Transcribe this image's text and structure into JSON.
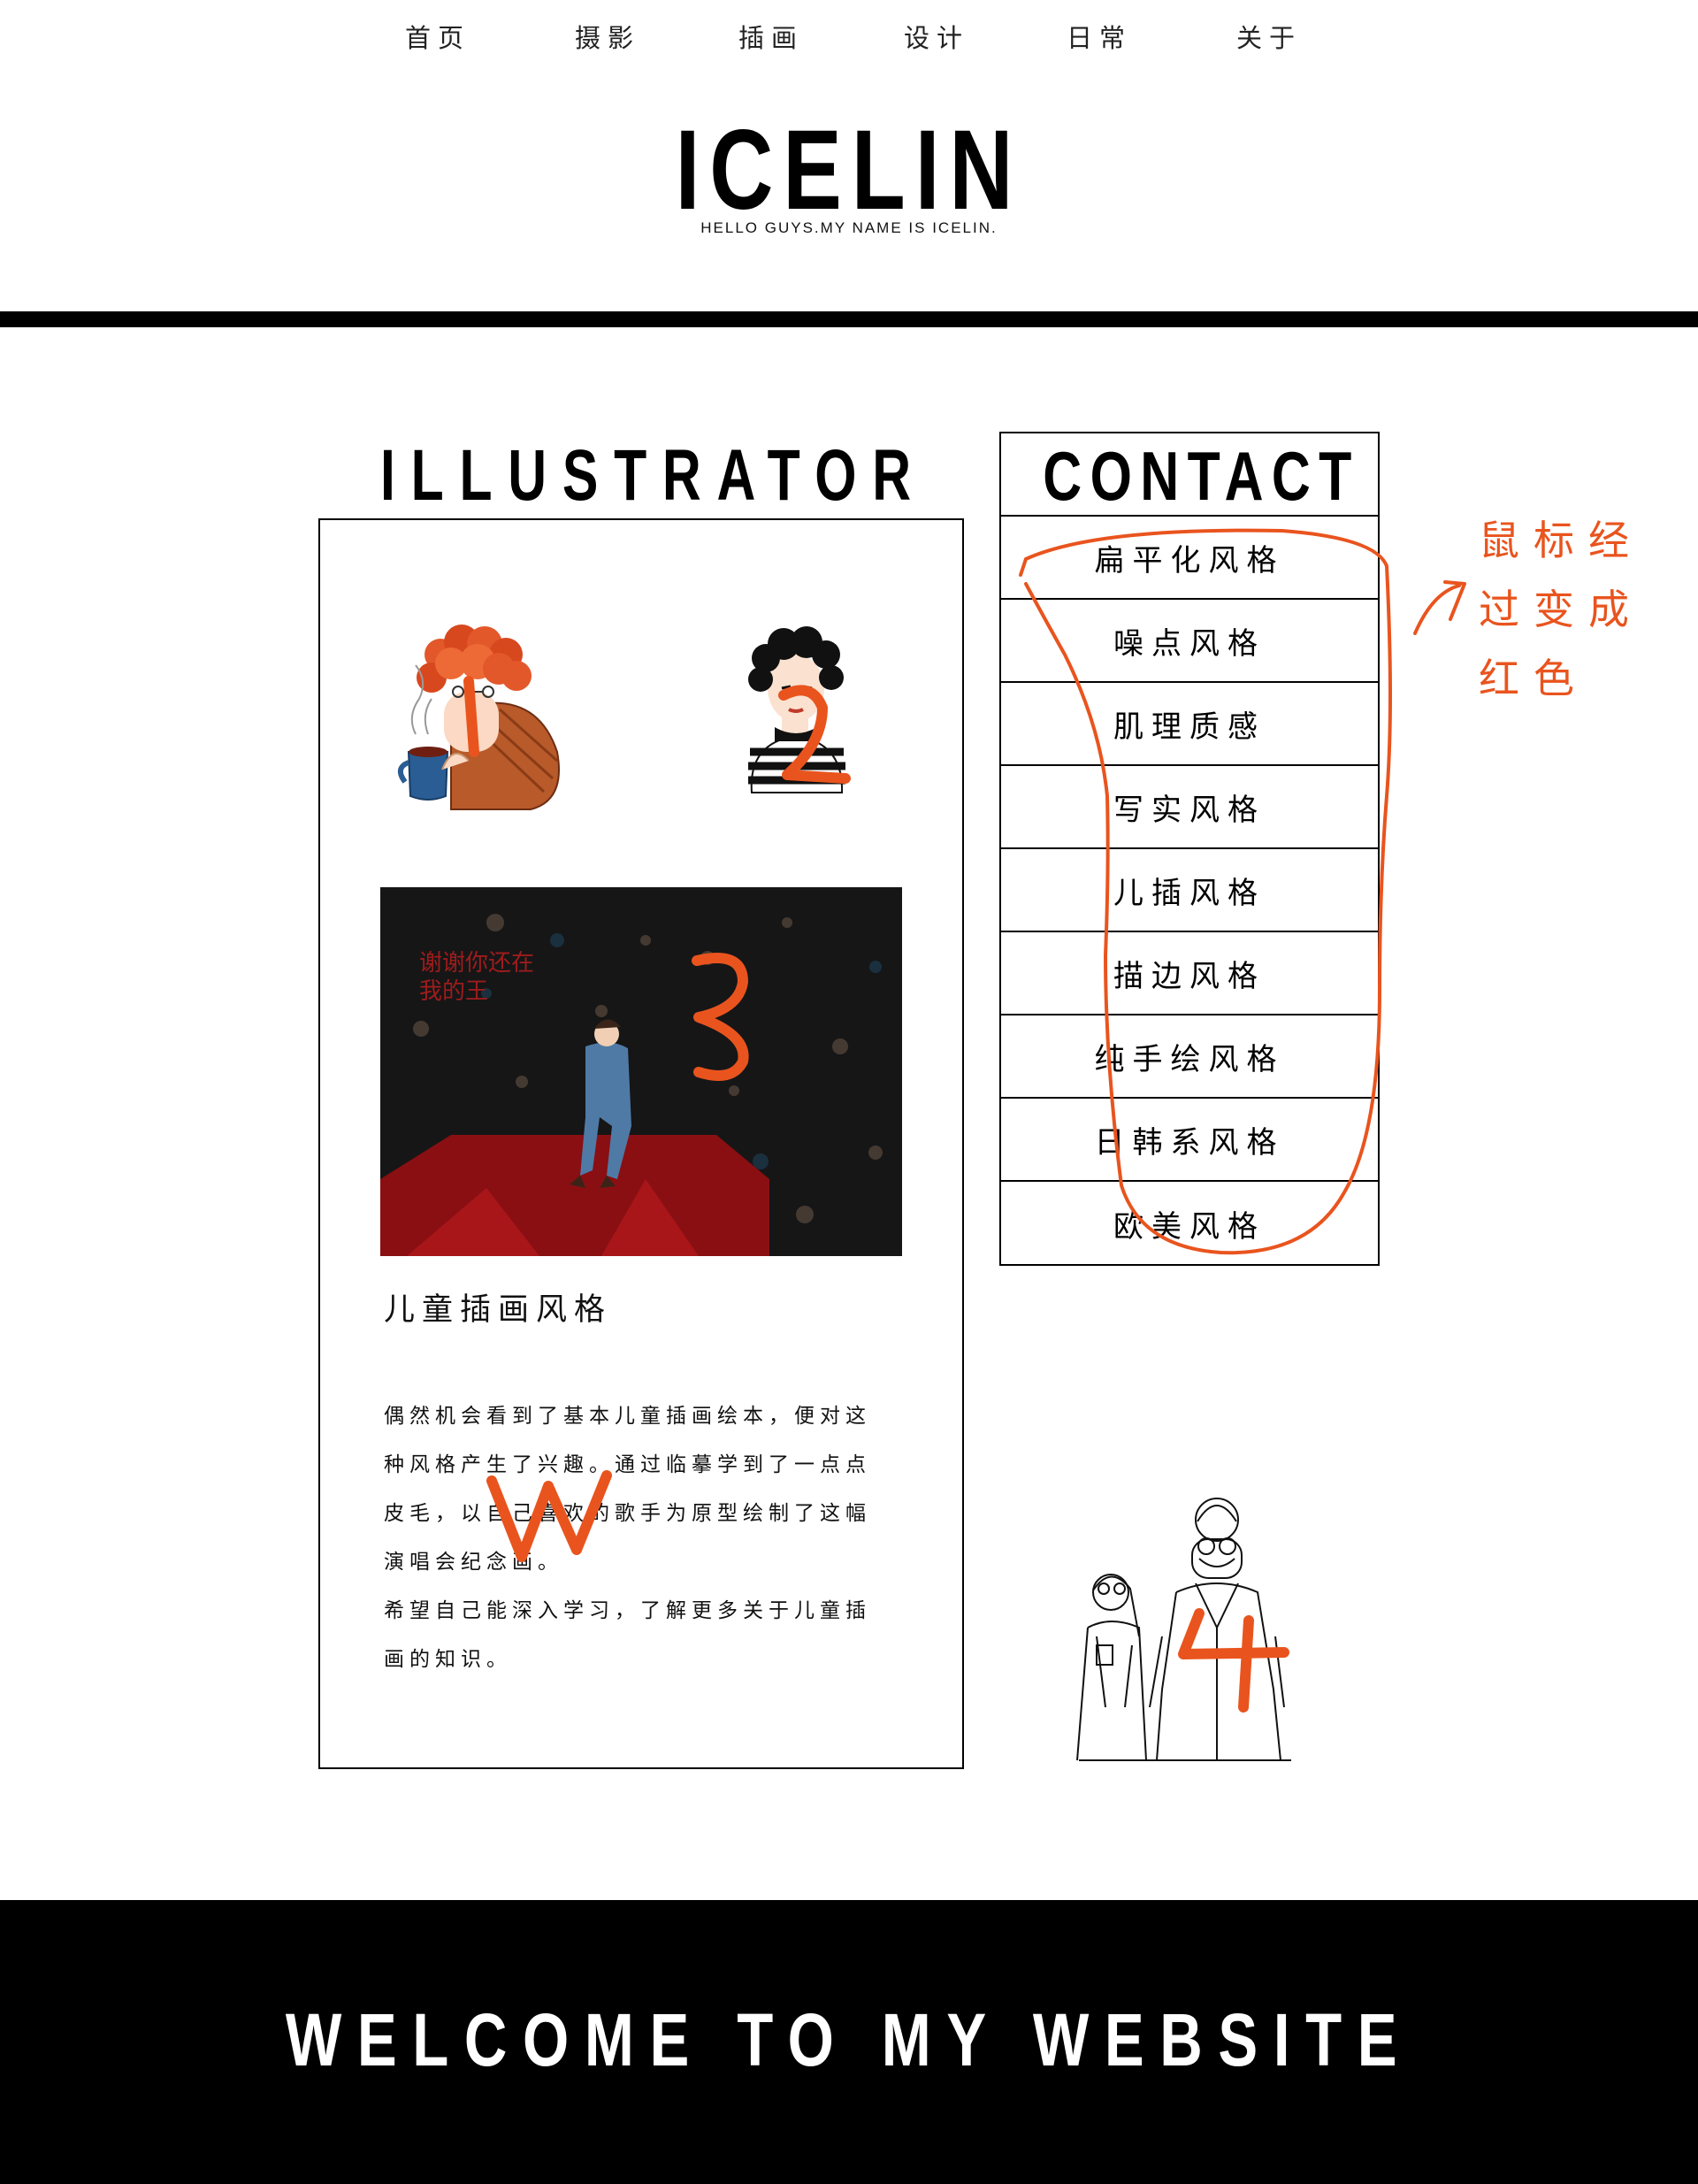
{
  "nav": {
    "items": [
      "首页",
      "摄影",
      "插画",
      "设计",
      "日常",
      "关于"
    ]
  },
  "header": {
    "logo": "ICELIN",
    "tagline": "HELLO GUYS.MY NAME IS ICELIN."
  },
  "illustrator": {
    "heading": "ILLUSTRATOR",
    "artwork_text": "谢谢你还在\n我的王",
    "caption": "儿童插画风格",
    "paragraphs": [
      "偶然机会看到了基本儿童插画绘本，便对这种风格产生了兴趣。通过临摹学到了一点点皮毛，以自己喜欢的歌手为原型绘制了这幅演唱会纪念画。",
      "希望自己能深入学习，了解更多关于儿童插画的知识。"
    ]
  },
  "contact": {
    "heading": "CONTACT",
    "items": [
      "扁平化风格",
      "噪点风格",
      "肌理质感",
      "写实风格",
      "儿插风格",
      "描边风格",
      "纯手绘风格",
      "日韩系风格",
      "欧美风格"
    ]
  },
  "annotations": {
    "hover_note": [
      "鼠标经",
      "过变成",
      "红色"
    ],
    "numbers": [
      "1",
      "2",
      "3",
      "4"
    ],
    "accent_color": "#e9541e"
  },
  "footer": {
    "text": "WELCOME TO MY WEBSITE"
  }
}
